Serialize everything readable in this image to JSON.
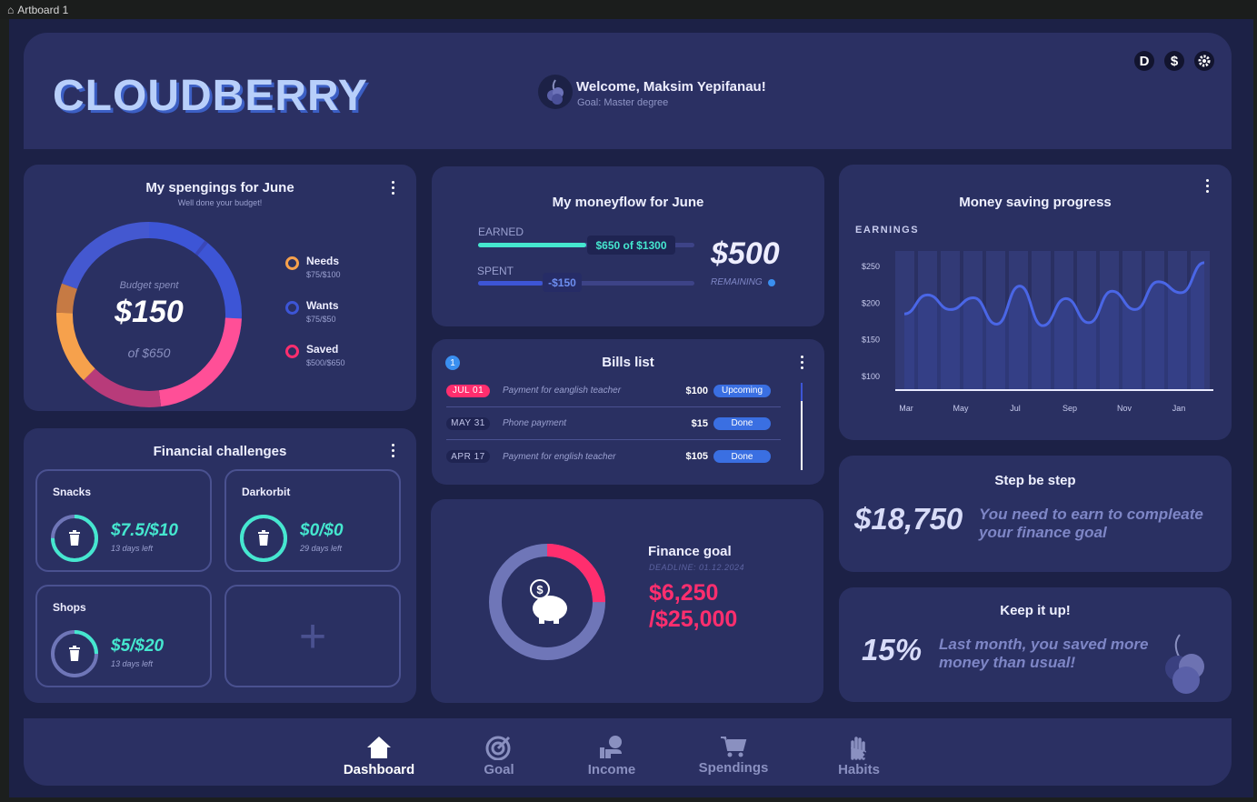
{
  "window": {
    "title": "Artboard 1"
  },
  "colors": {
    "bg": "#1c2146",
    "card": "#2a3062",
    "accent": "#45e7cf",
    "pink": "#ff2e6e",
    "blue": "#3a6fe2"
  },
  "header": {
    "logo": "CLOUDBERRY",
    "welcome": "Welcome, Maksim Yepifanau!",
    "goal": "Goal: Master degree",
    "icons": [
      "D",
      "$"
    ]
  },
  "spendings": {
    "title": "My spengings for June",
    "subtitle": "Well done your budget!",
    "budget_label": "Budget spent",
    "amount": "$150",
    "of": "of $650",
    "legend": [
      {
        "name": "Needs",
        "value": "$75/$100",
        "color": "#f6a14c"
      },
      {
        "name": "Wants",
        "value": "$75/$50",
        "color": "#3d55d6"
      },
      {
        "name": "Saved",
        "value": "$500/$650",
        "color": "#ff2e6e"
      }
    ]
  },
  "moneyflow": {
    "title": "My moneyflow for June",
    "earned_label": "EARNED",
    "earned_value": "$650 of $1300",
    "earned_fraction": 0.5,
    "spent_label": "SPENT",
    "spent_value": "-$150",
    "spent_fraction": 0.3,
    "remaining_amount": "$500",
    "remaining_label": "REMAINING"
  },
  "bills": {
    "title": "Bills list",
    "count": "1",
    "rows": [
      {
        "date": "JUL 01",
        "desc": "Payment for eanglish teacher",
        "amount": "$100",
        "status": "Upcoming"
      },
      {
        "date": "MAY 31",
        "desc": "Phone payment",
        "amount": "$15",
        "status": "Done"
      },
      {
        "date": "APR 17",
        "desc": "Payment for english teacher",
        "amount": "$105",
        "status": "Done"
      }
    ]
  },
  "saving": {
    "title": "Money saving progress",
    "series_label": "EARNINGS"
  },
  "chart_data": {
    "type": "line",
    "x_ticks": [
      "Mar",
      "May",
      "Jul",
      "Sep",
      "Nov",
      "Jan"
    ],
    "y_ticks": [
      "$250",
      "$200",
      "$150",
      "$100"
    ],
    "ylim": [
      100,
      250
    ],
    "points": [
      [
        0,
        184
      ],
      [
        1,
        210
      ],
      [
        2,
        190
      ],
      [
        3,
        206
      ],
      [
        4,
        170
      ],
      [
        5,
        222
      ],
      [
        6,
        168
      ],
      [
        7,
        205
      ],
      [
        8,
        172
      ],
      [
        9,
        215
      ],
      [
        10,
        190
      ],
      [
        11,
        228
      ],
      [
        12,
        213
      ],
      [
        13,
        254
      ]
    ],
    "grid": true,
    "legend": "none"
  },
  "step": {
    "title": "Step be step",
    "amount": "$18,750",
    "text": "You need to earn to compleate your finance goal"
  },
  "challenges": {
    "title": "Financial challenges",
    "items": [
      {
        "name": "Snacks",
        "amount": "$7.5/$10",
        "left": "13 days left",
        "progress": 0.75
      },
      {
        "name": "Darkorbit",
        "amount": "$0/$0",
        "left": "29 days left",
        "progress": 1.0
      },
      {
        "name": "Shops",
        "amount": "$5/$20",
        "left": "13 days left",
        "progress": 0.25
      }
    ],
    "add_glyph": "+"
  },
  "finance_goal": {
    "title": "Finance goal",
    "deadline": "DEADLINE: 01.12.2024",
    "current": "$6,250",
    "target": "/$25,000",
    "progress": 0.25
  },
  "keepup": {
    "title": "Keep it up!",
    "percent": "15%",
    "text": "Last month, you saved more money than usual!"
  },
  "nav": {
    "items": [
      {
        "label": "Dashboard",
        "icon": "home-icon"
      },
      {
        "label": "Goal",
        "icon": "target-icon"
      },
      {
        "label": "Income",
        "icon": "income-icon"
      },
      {
        "label": "Spendings",
        "icon": "cart-icon"
      },
      {
        "label": "Habits",
        "icon": "hand-icon"
      }
    ]
  }
}
